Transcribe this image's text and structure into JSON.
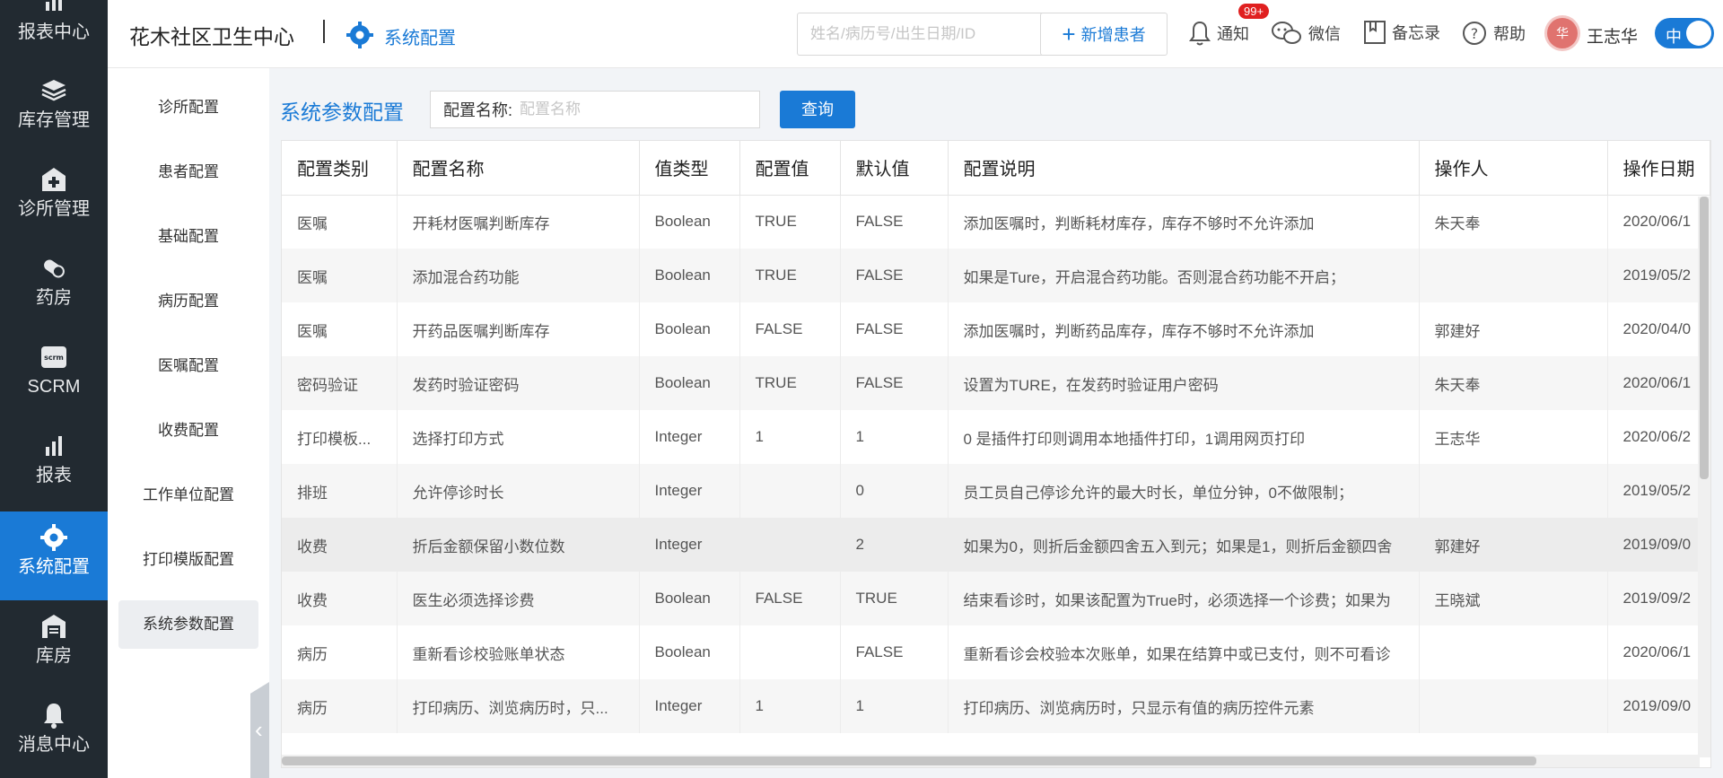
{
  "leftnav": {
    "items": [
      {
        "label": "报表中心",
        "icon": "report-center-icon"
      },
      {
        "label": "库存管理",
        "icon": "stack-icon"
      },
      {
        "label": "诊所管理",
        "icon": "clinic-plus-icon"
      },
      {
        "label": "药房",
        "icon": "pill-icon"
      },
      {
        "label": "SCRM",
        "icon": "scrm-icon"
      },
      {
        "label": "报表",
        "icon": "bar-chart-icon"
      },
      {
        "label": "系统配置",
        "icon": "gear-icon"
      },
      {
        "label": "库房",
        "icon": "warehouse-icon"
      },
      {
        "label": "消息中心",
        "icon": "bell-icon"
      }
    ],
    "active_index": 6
  },
  "header": {
    "site_title": "花木社区卫生中心",
    "section_title": "系统配置",
    "search_placeholder": "姓名/病历号/出生日期/ID",
    "add_patient_label": "新增患者",
    "notify_label": "通知",
    "notify_badge": "99+",
    "wechat_label": "微信",
    "memo_label": "备忘录",
    "help_label": "帮助",
    "avatar_text": "华",
    "user_name": "王志华",
    "lang_toggle": "中"
  },
  "submenu": {
    "items": [
      "诊所配置",
      "患者配置",
      "基础配置",
      "病历配置",
      "医嘱配置",
      "收费配置",
      "工作单位配置",
      "打印模版配置",
      "系统参数配置"
    ],
    "active_index": 8
  },
  "main": {
    "page_title": "系统参数配置",
    "filter_label": "配置名称:",
    "filter_placeholder": "配置名称",
    "query_label": "查询"
  },
  "table": {
    "columns": [
      "配置类别",
      "配置名称",
      "值类型",
      "配置值",
      "默认值",
      "配置说明",
      "操作人",
      "操作日期"
    ],
    "rows": [
      [
        "医嘱",
        "开耗材医嘱判断库存",
        "Boolean",
        "TRUE",
        "FALSE",
        "添加医嘱时，判断耗材库存，库存不够时不允许添加",
        "朱天奉",
        "2020/06/1"
      ],
      [
        "医嘱",
        "添加混合药功能",
        "Boolean",
        "TRUE",
        "FALSE",
        "如果是Ture，开启混合药功能。否则混合药功能不开启；",
        "",
        "2019/05/2"
      ],
      [
        "医嘱",
        "开药品医嘱判断库存",
        "Boolean",
        "FALSE",
        "FALSE",
        "添加医嘱时，判断药品库存，库存不够时不允许添加",
        "郭建好",
        "2020/04/0"
      ],
      [
        "密码验证",
        "发药时验证密码",
        "Boolean",
        "TRUE",
        "FALSE",
        "设置为TURE，在发药时验证用户密码",
        "朱天奉",
        "2020/06/1"
      ],
      [
        "打印模板...",
        "选择打印方式",
        "Integer",
        "1",
        "1",
        "0 是插件打印则调用本地插件打印，1调用网页打印",
        "王志华",
        "2020/06/2"
      ],
      [
        "排班",
        "允许停诊时长",
        "Integer",
        "",
        "0",
        "员工员自己停诊允许的最大时长，单位分钟，0不做限制；",
        "",
        "2019/05/2"
      ],
      [
        "收费",
        "折后金额保留小数位数",
        "Integer",
        "",
        "2",
        "如果为0，则折后金额四舍五入到元；如果是1，则折后金额四舍",
        "郭建好",
        "2019/09/0"
      ],
      [
        "收费",
        "医生必须选择诊费",
        "Boolean",
        "FALSE",
        "TRUE",
        "结束看诊时，如果该配置为True时，必须选择一个诊费；如果为",
        "王晓斌",
        "2019/09/2"
      ],
      [
        "病历",
        "重新看诊校验账单状态",
        "Boolean",
        "",
        "FALSE",
        "重新看诊会校验本次账单，如果在结算中或已支付，则不可看诊",
        "",
        "2020/06/1"
      ],
      [
        "病历",
        "打印病历、浏览病历时，只...",
        "Integer",
        "1",
        "1",
        "打印病历、浏览病历时，只显示有值的病历控件元素",
        "",
        "2019/09/0"
      ]
    ],
    "highlighted_row": 6
  },
  "colors": {
    "primary": "#1a7ad6",
    "nav_bg": "#222a31",
    "badge": "#e02020"
  }
}
